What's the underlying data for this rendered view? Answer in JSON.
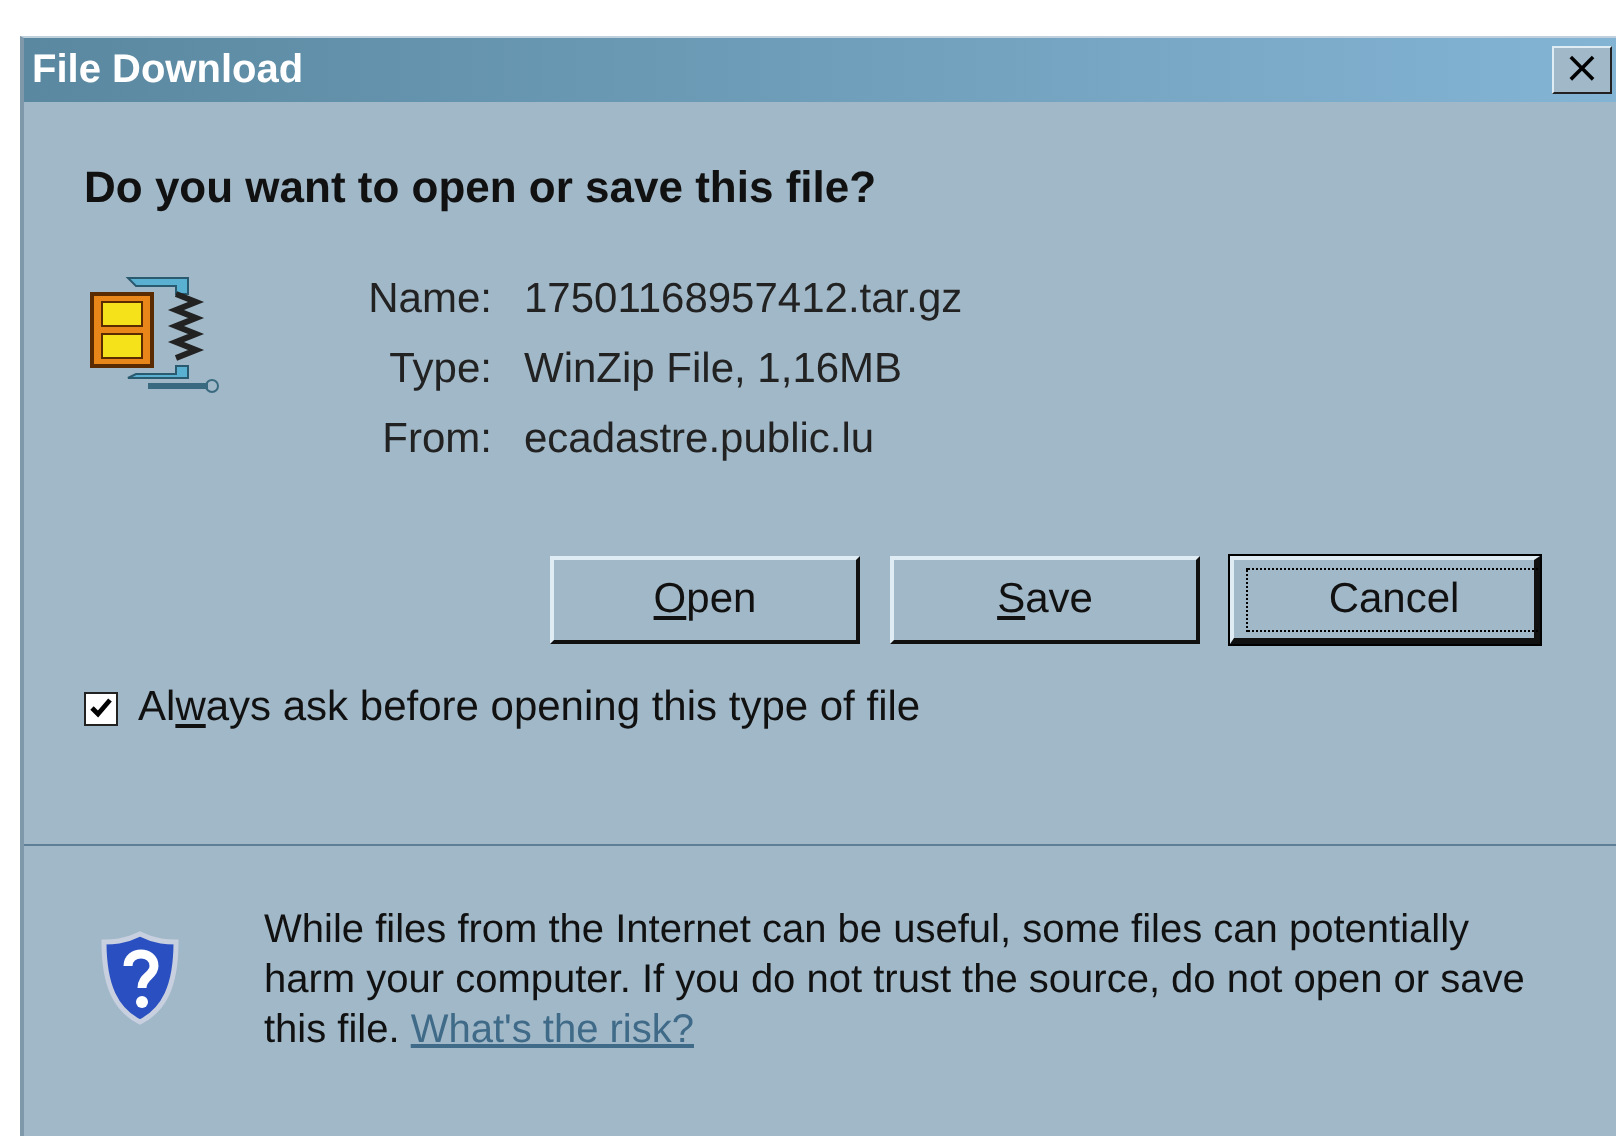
{
  "window": {
    "title": "File Download",
    "close": "×"
  },
  "heading": "Do you want to open or save this file?",
  "fields": [
    {
      "label": "Name:",
      "value": "17501168957412.tar.gz"
    },
    {
      "label": "Type:",
      "value": "WinZip File, 1,16MB"
    },
    {
      "label": "From:",
      "value": "ecadastre.public.lu"
    }
  ],
  "buttons": [
    {
      "label_parts": [
        {
          "text": "O",
          "underlined": true
        },
        {
          "text": "pen",
          "underlined": false
        }
      ],
      "selected": false
    },
    {
      "label_parts": [
        {
          "text": "S",
          "underlined": true
        },
        {
          "text": "ave",
          "underlined": false
        }
      ],
      "selected": false
    },
    {
      "label_parts": [
        {
          "text": "Cancel",
          "underlined": false
        }
      ],
      "selected": true
    }
  ],
  "checkbox": {
    "label_parts": [
      {
        "text": "Al",
        "underlined": false
      },
      {
        "text": "w",
        "underlined": true
      },
      {
        "text": "ays ask before opening this type of file",
        "underlined": false
      }
    ],
    "checked": true
  },
  "warning": {
    "text": "While files from the Internet can be useful, some files can potentially harm your computer. If you do not trust the source, do not open or save this file.",
    "link": "What's the risk?"
  }
}
